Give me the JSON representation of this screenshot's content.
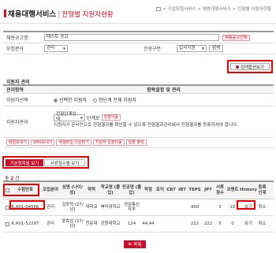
{
  "header": {
    "title": "채용대행서비스",
    "separator": "|",
    "subtitle": "전형별 지원자현황",
    "breadcrumb": "> 기업회원서비스 > 채용대행서비스 > 전형별 지원자현황"
  },
  "search_form": {
    "posting_label": "채용공고명",
    "posting_value": "테스트 공고",
    "posting_button": "채용공고선택",
    "field_label": "모집분야",
    "field_value": "관리",
    "stage_label": "전형구분",
    "stage_value": "입사지원",
    "search_small_button": "검색",
    "search_button": "검색옵션보기"
  },
  "management": {
    "section_title": "지원자 관리",
    "col_item": "관리항목",
    "col_setting": "항목설정 및 관리",
    "select_label": "지원자선택",
    "option_selected": "선택한 지원자",
    "option_all": "현단계 전체 지원자",
    "manage_label": "지원자관리",
    "stage_select": "전형단계선택",
    "stage_suffix": "단계로",
    "move_button": "전형이동",
    "description": "지원자가 온라인으로 전형결과를 확인할 수 있도록 전형결과관리에서 전형결과를 등록하셔야 합니다.",
    "action_buttons": [
      "메일보내기",
      "SMS보내기",
      "엑셀파일 다운받기",
      "지원자 일괄이동",
      "일괄 출력"
    ]
  },
  "view_buttons": {
    "basic": "기본항목별 보기",
    "score": "서류점수별 보기"
  },
  "total": {
    "prefix": "총",
    "count": "2",
    "suffix": "건"
  },
  "table": {
    "headers": [
      "",
      "수험번호",
      "모집분야",
      "성명 (나이/성)",
      "학력",
      "학교명 (졸업)",
      "전공명 (졸업)",
      "학점",
      "토익",
      "CBT",
      "IBT",
      "TEPS",
      "JPT",
      "서류 점수",
      "코멘트",
      "History",
      "등록 인재"
    ],
    "rows": [
      [
        "",
        "K.A01-04566",
        "관리",
        "김정혁 (27/남)",
        "대학교",
        "북익대학교",
        "정보통신 학부",
        "",
        "",
        "",
        "",
        "400",
        "",
        "3",
        "22",
        "보기",
        "취소"
      ],
      [
        "",
        "K.A01-52297",
        "관리",
        "윤호섭 (27/남)",
        "전문대",
        "강원대학교",
        "124",
        "44,44",
        "",
        "",
        "",
        "222",
        "222",
        "5",
        "0",
        "보기",
        "취소"
      ]
    ]
  },
  "list_button": "목록",
  "colors": {
    "accent": "#c8102e",
    "highlight": "#ee0000"
  }
}
